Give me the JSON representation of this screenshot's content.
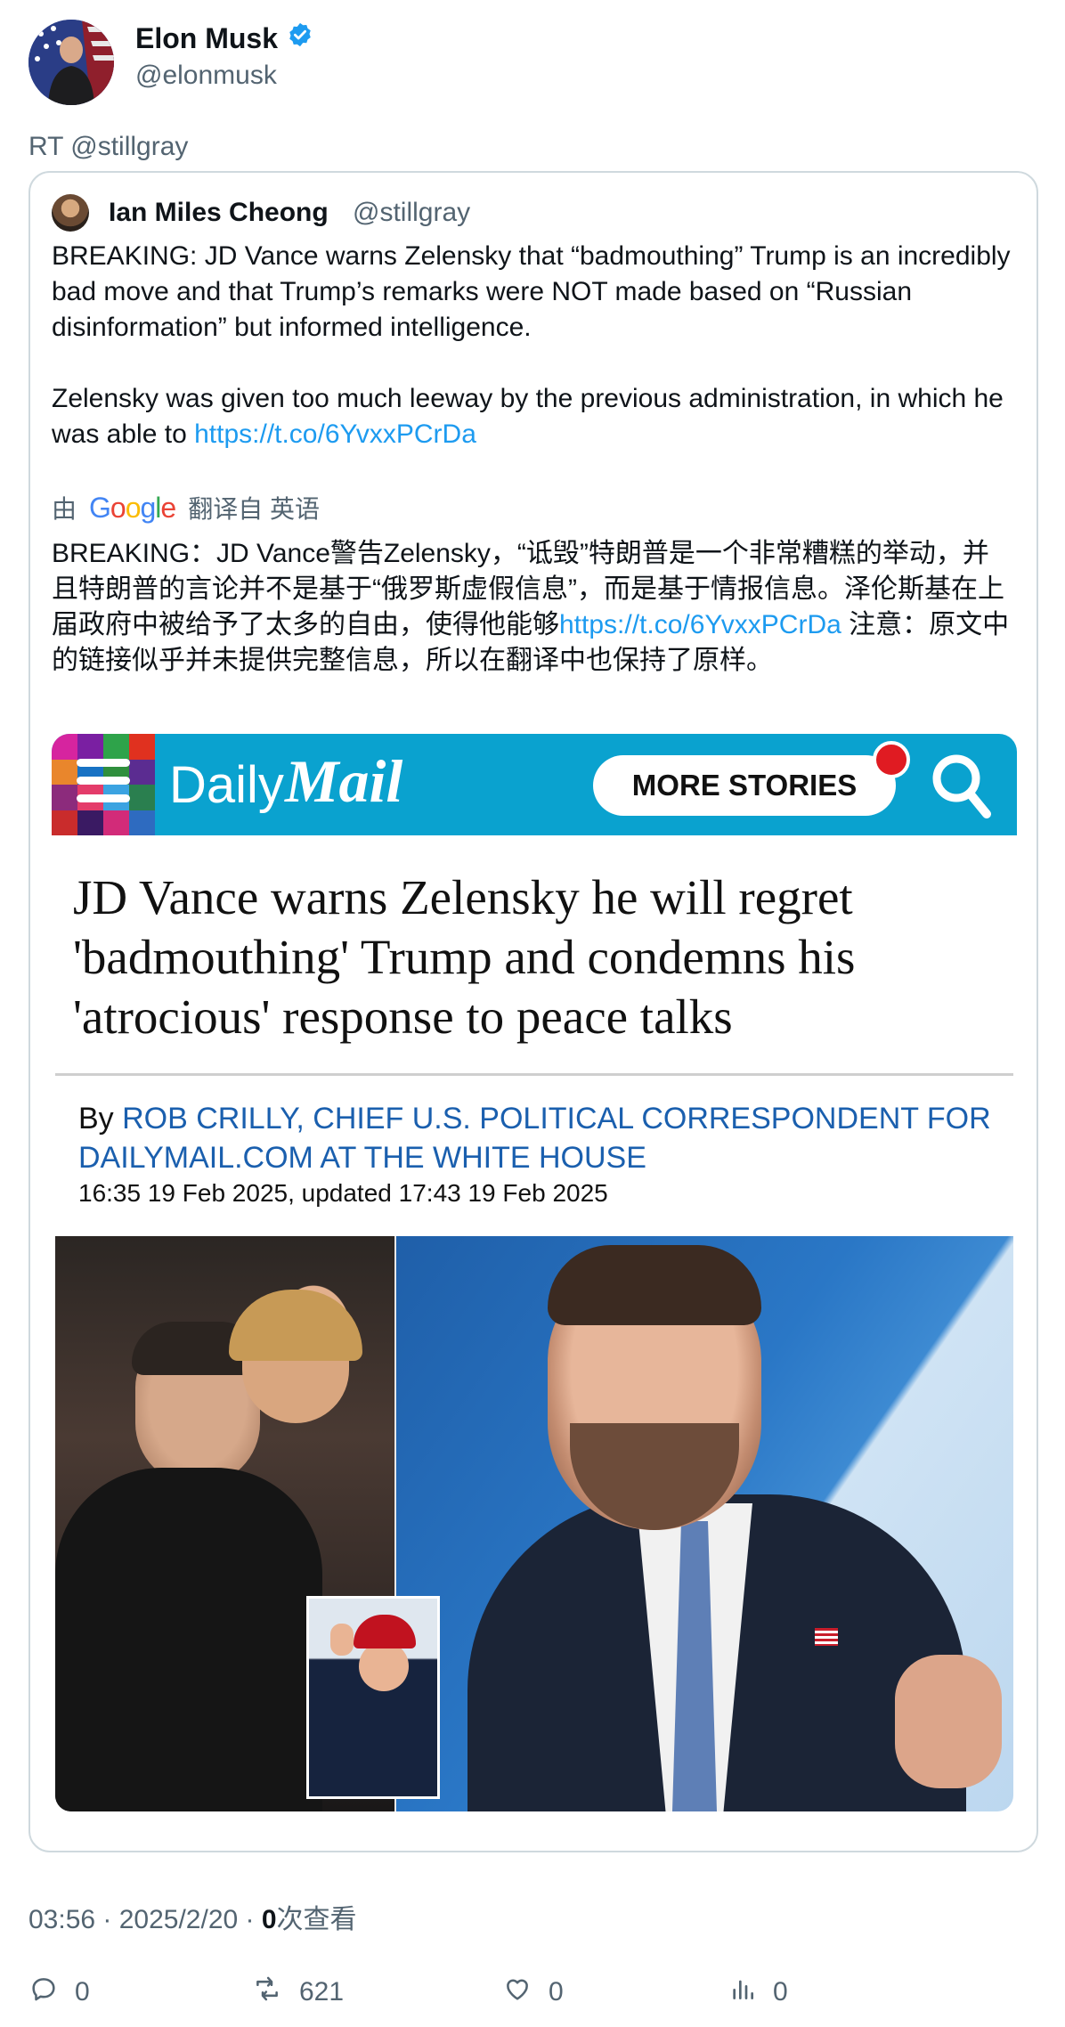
{
  "author": {
    "name": "Elon Musk",
    "handle": "@elonmusk",
    "verified": true,
    "verified_color": "#1d9bf0"
  },
  "retweet_line": "RT @stillgray",
  "quoted": {
    "name": "Ian Miles Cheong",
    "handle": "@stillgray",
    "paragraph1": "BREAKING: JD Vance warns Zelensky that “badmouthing” Trump is an incredibly bad move and that Trump’s remarks were NOT made based on “Russian disinformation” but informed intelligence.",
    "paragraph2_text": "Zelensky was given too much leeway by the previous administration, in which he was able to ",
    "paragraph2_link": "https://t.co/6YvxxPCrDa",
    "translate": {
      "prefix": "由",
      "provider": "Google",
      "suffix": "翻译自 英语"
    },
    "translation_text": "BREAKING：JD Vance警告Zelensky，“诋毁”特朗普是一个非常糟糕的举动，并且特朗普的言论并不是基于“俄罗斯虚假信息”，而是基于情报信息。泽伦斯基在上届政府中被给予了太多的自由，使得他能够",
    "translation_link": "https://t.co/6YvxxPCrDa",
    "translation_note": " 注意：原文中的链接似乎并未提供完整信息，所以在翻译中也保持了原样。"
  },
  "article": {
    "site_daily": "Daily",
    "site_mail": "Mail",
    "more_stories": "MORE STORIES",
    "headline": "JD Vance warns Zelensky he will regret 'badmouthing' Trump and condemns his 'atrocious' response to peace talks",
    "by_prefix": "By ",
    "byline": "ROB CRILLY, CHIEF U.S. POLITICAL CORRESPONDENT FOR DAILYMAIL.COM AT THE WHITE HOUSE",
    "dateline": "16:35 19 Feb 2025, updated 17:43 19 Feb 2025",
    "banner_color": "#0aa2cf"
  },
  "meta": {
    "time": "03:56 · 2025/2/20 · ",
    "views_count": "0",
    "views_label": "次查看"
  },
  "actions": {
    "replies": "0",
    "retweets": "621",
    "likes": "0",
    "views": "0"
  },
  "icons": [
    "verified-badge-icon",
    "google-logo",
    "hamburger-menu-icon",
    "search-icon",
    "reply-icon",
    "retweet-icon",
    "like-icon",
    "analytics-icon"
  ]
}
